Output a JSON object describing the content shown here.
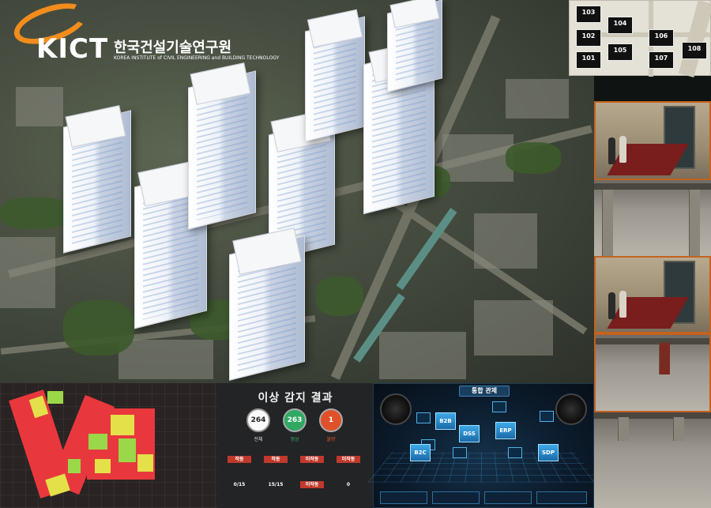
{
  "logo": {
    "brand": "KICT",
    "korean_name": "한국건설기술연구원",
    "english_name": "KOREA INSTITUTE of CIVIL ENGINEERING and BUILDING TECHNOLOGY"
  },
  "floor_map": {
    "rooms": [
      "103",
      "104",
      "102",
      "106",
      "101",
      "105",
      "107",
      "108"
    ]
  },
  "anomaly_panel": {
    "title": "이상 감지 결과",
    "summary": [
      {
        "value": "264",
        "label": "전체",
        "color": "#e8e8e8"
      },
      {
        "value": "263",
        "label": "정상",
        "color": "#3bb36a"
      },
      {
        "value": "1",
        "label": "불량",
        "color": "#e0502a"
      }
    ],
    "stats": [
      {
        "caption": "",
        "value": "작동",
        "color": "#c0392b"
      },
      {
        "caption": "",
        "value": "작동",
        "color": "#c0392b"
      },
      {
        "caption": "",
        "value": "미작동",
        "color": "#c0392b"
      },
      {
        "caption": "",
        "value": "미작동",
        "color": "#c0392b"
      },
      {
        "caption": "",
        "value": "0/15",
        "color": ""
      },
      {
        "caption": "",
        "value": "15/15",
        "color": ""
      },
      {
        "caption": "",
        "value": "미작동",
        "color": "#c0392b"
      },
      {
        "caption": "",
        "value": "0",
        "color": ""
      }
    ]
  },
  "control_panel": {
    "title": "통합 관제",
    "nodes": [
      "B2C",
      "DSS",
      "ERP",
      "SDP",
      "B2B"
    ]
  }
}
